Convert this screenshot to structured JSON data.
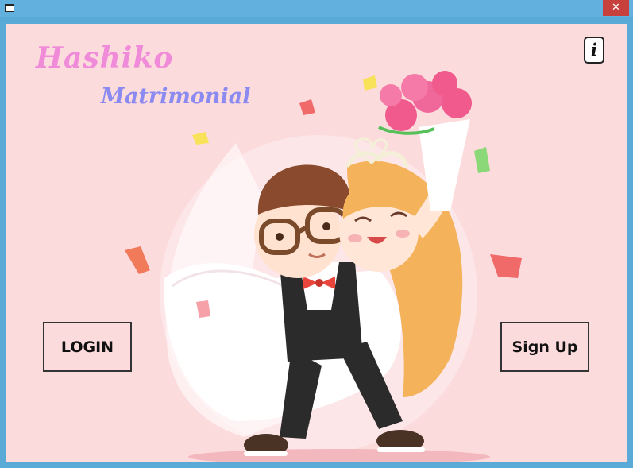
{
  "window": {
    "close_glyph": "✕",
    "icons": {
      "app": "window-icon",
      "close": "close-icon"
    }
  },
  "logo": {
    "line1": "Hashiko",
    "line2": "Matrimonial",
    "colors": {
      "line1": "#f08bd9",
      "line2": "#8b8af0"
    }
  },
  "info_button": {
    "label": "i",
    "icon": "info-icon"
  },
  "login_button": {
    "label": "LOGIN"
  },
  "signup_button": {
    "label": "Sign Up"
  },
  "illustration": {
    "subject": "wedding-couple-illustration"
  },
  "colors": {
    "background": "#fcdbdd",
    "titlebar": "#62b0de",
    "close": "#c7403b"
  }
}
